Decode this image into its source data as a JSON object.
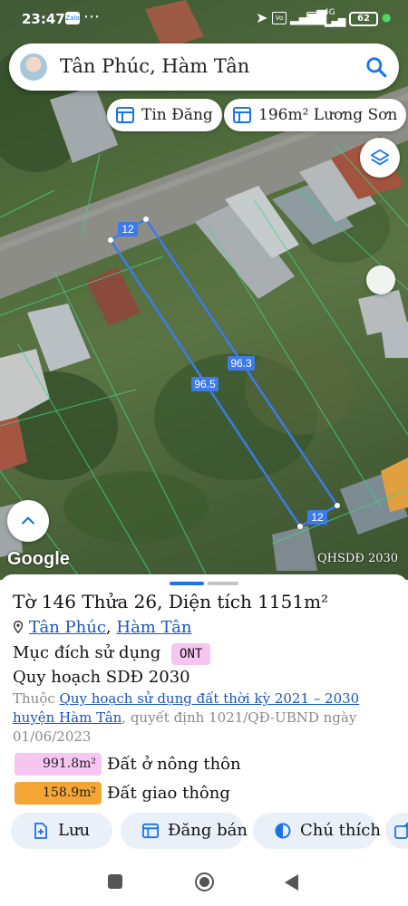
{
  "status_bar": {
    "time": "23:47",
    "icons": [
      "zalo-icon",
      "more-icon",
      "location-icon",
      "volte-icon",
      "signal-icon",
      "4g-icon",
      "signal-icon"
    ],
    "battery": "62"
  },
  "search": {
    "query": "Tân Phúc, Hàm Tân",
    "icon": "search-icon"
  },
  "chips": [
    {
      "label": "Tin Đăng",
      "icon": "list-icon"
    },
    {
      "label": "196m² Lương Sơn",
      "icon": "list-icon"
    }
  ],
  "map": {
    "labels": {
      "top": "12",
      "bottom": "12",
      "left_side": "96.5",
      "right_side": "96.3"
    },
    "attribution": "Google",
    "layer_tag": "QHSDĐ 2030",
    "boundary_color": "#3d7bea"
  },
  "parcel": {
    "title": "Tờ 146 Thửa 26, Diện tích 1151m²",
    "commune": "Tân Phúc",
    "separator": ", ",
    "district": "Hàm Tân",
    "purpose_label": "Mục đích sử dụng",
    "purpose_code": "ONT",
    "plan_title": "Quy hoạch SDĐ 2030",
    "plan_prefix": "Thuộc ",
    "plan_link": "Quy hoạch sử dụng đất thời kỳ 2021 – 2030 huyện Hàm Tân",
    "plan_suffix": ", quyết định 1021/QĐ-UBND ngày 01/06/2023",
    "uses": [
      {
        "area": "991.8m²",
        "label": "Đất ở nông thôn",
        "color": "#f6c6f1"
      },
      {
        "area": "158.9m²",
        "label": "Đất giao thông",
        "color": "#f4a534"
      }
    ]
  },
  "actions": [
    {
      "label": "Lưu",
      "icon": "bookmark-add-icon"
    },
    {
      "label": "Đăng bán",
      "icon": "list-icon"
    },
    {
      "label": "Chú thích",
      "icon": "contrast-icon"
    },
    {
      "label": "",
      "icon": "add-photo-icon"
    }
  ],
  "colors": {
    "accent": "#1a73e8",
    "link": "#1a56b8",
    "action_bg": "#eaf0f8"
  }
}
